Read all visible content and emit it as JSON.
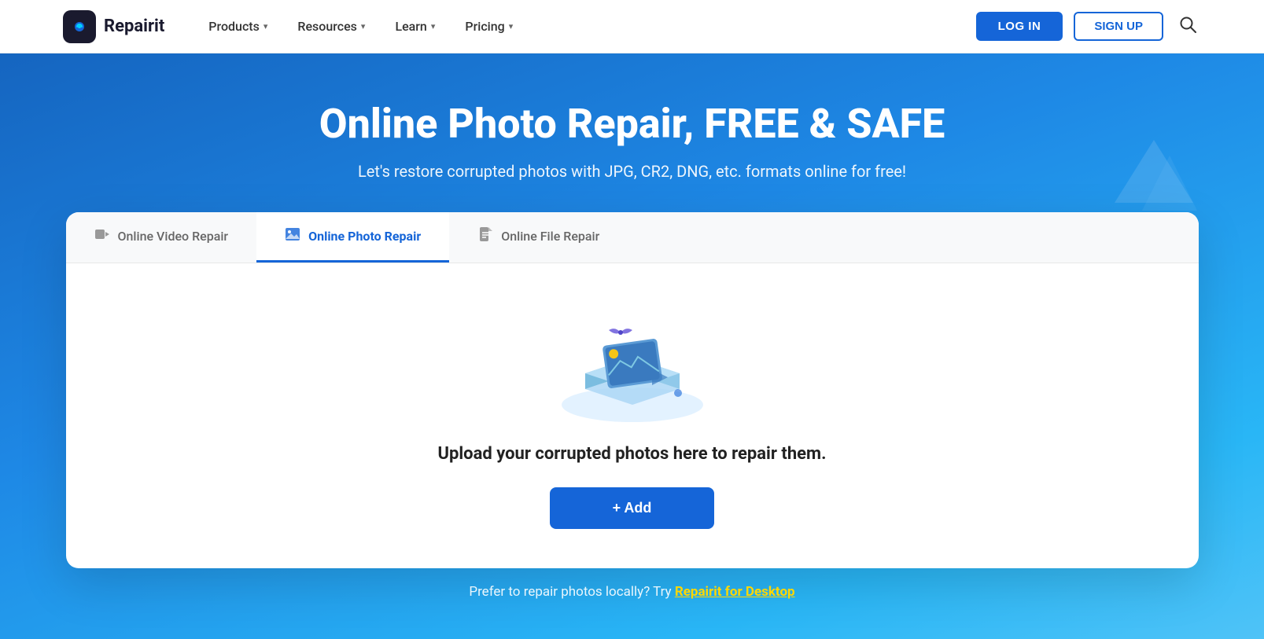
{
  "navbar": {
    "logo_text": "Repairit",
    "nav_items": [
      {
        "label": "Products",
        "has_dropdown": true
      },
      {
        "label": "Resources",
        "has_dropdown": true
      },
      {
        "label": "Learn",
        "has_dropdown": true
      },
      {
        "label": "Pricing",
        "has_dropdown": true
      }
    ],
    "login_label": "LOG IN",
    "signup_label": "SIGN UP"
  },
  "hero": {
    "title": "Online Photo Repair, FREE & SAFE",
    "subtitle": "Let's restore corrupted photos with JPG, CR2, DNG, etc. formats online for free!"
  },
  "tabs": [
    {
      "id": "video",
      "label": "Online Video Repair",
      "active": false
    },
    {
      "id": "photo",
      "label": "Online Photo Repair",
      "active": true
    },
    {
      "id": "file",
      "label": "Online File Repair",
      "active": false
    }
  ],
  "card": {
    "upload_text": "Upload your corrupted photos here to repair them.",
    "add_button_label": "+ Add"
  },
  "footer_text": {
    "prefix": "Prefer to repair photos locally? Try ",
    "link_label": "Repairit for Desktop"
  }
}
